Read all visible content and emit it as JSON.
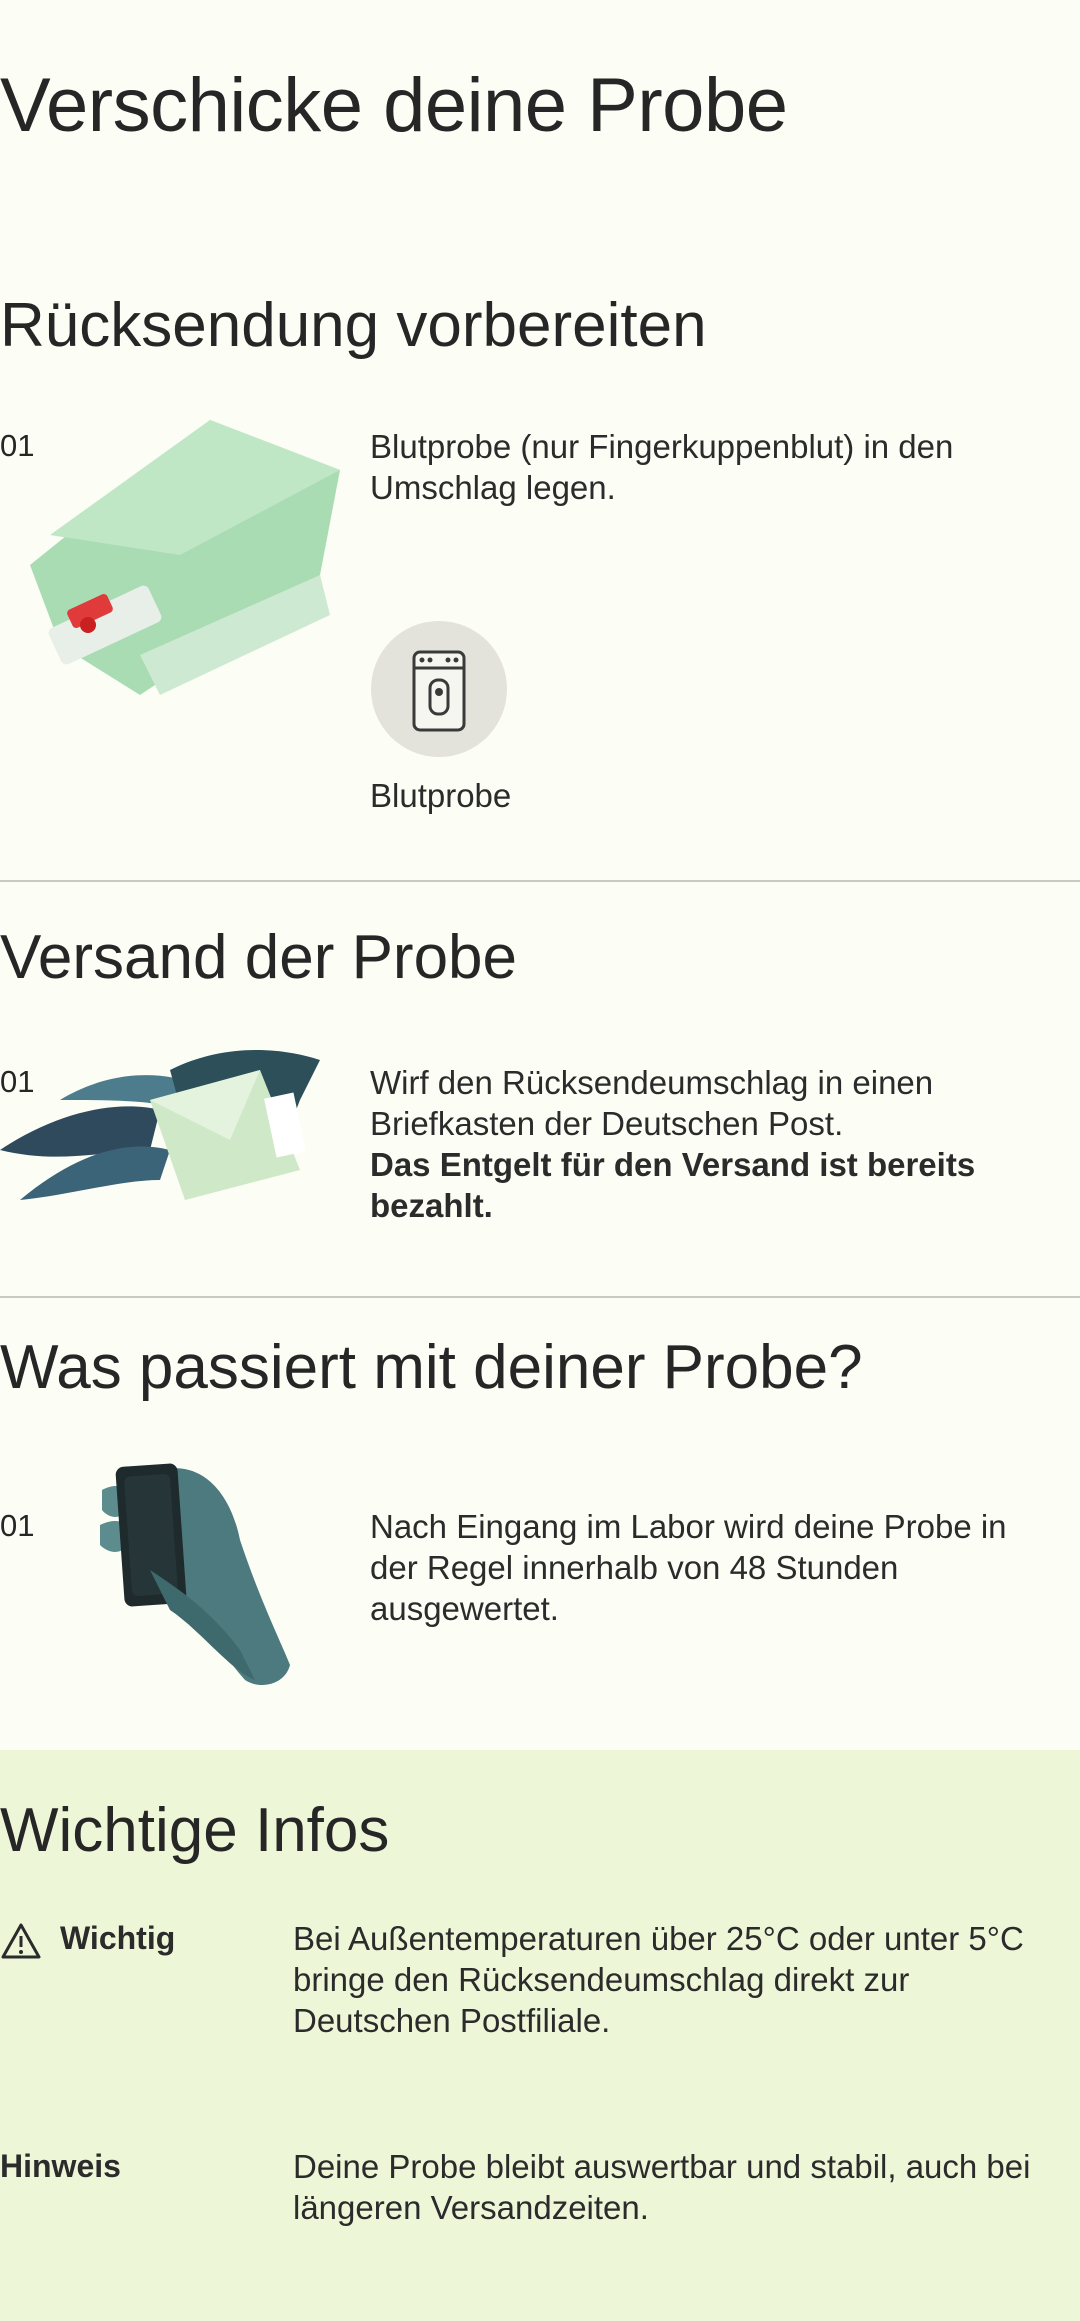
{
  "page": {
    "title": "Verschicke deine Probe"
  },
  "sections": [
    {
      "title": "Rücksendung vorbereiten",
      "step": "01",
      "text": "Blutprobe (nur Fingerkuppenblut) in den Umschlag legen.",
      "chip_label": "Blutprobe",
      "icon": "envelope-illustration"
    },
    {
      "title": "Versand der Probe",
      "step": "01",
      "text_line1": "Wirf den Rücksendeumschlag in einen Briefkasten der Deutschen Post.",
      "text_bold": "Das Entgelt für den Versand ist bereits bezahlt.",
      "icon": "flying-envelope-illustration"
    },
    {
      "title": "Was passiert mit deiner Probe?",
      "step": "01",
      "text": "Nach Eingang im Labor wird deine Probe in der Regel innerhalb von 48 Stunden ausgewertet.",
      "icon": "hand-holding-sample-illustration"
    }
  ],
  "info": {
    "title": "Wichtige Infos",
    "items": [
      {
        "label": "Wichtig",
        "icon": "warning-icon",
        "text": "Bei Außentemperaturen über 25°C oder unter 5°C bringe den Rücksendeumschlag direkt zur Deutschen Postfiliale."
      },
      {
        "label": "Hinweis",
        "text": "Deine Probe bleibt auswertbar und stabil, auch bei längeren Versandzeiten."
      }
    ]
  }
}
